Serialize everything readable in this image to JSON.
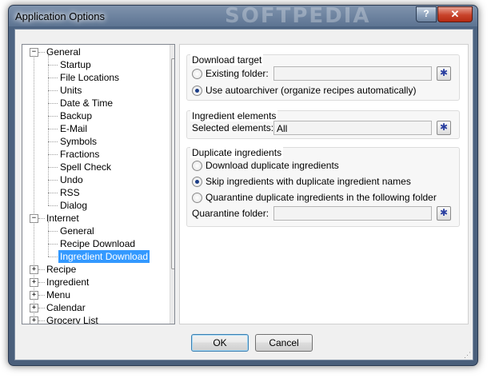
{
  "window": {
    "title": "Application Options",
    "watermark": "SOFTPEDIA",
    "help_glyph": "?",
    "close_glyph": "✕"
  },
  "tree": {
    "items": [
      {
        "label": "General",
        "level": 0,
        "expander": "−"
      },
      {
        "label": "Startup",
        "level": 1
      },
      {
        "label": "File Locations",
        "level": 1
      },
      {
        "label": "Units",
        "level": 1
      },
      {
        "label": "Date & Time",
        "level": 1
      },
      {
        "label": "Backup",
        "level": 1
      },
      {
        "label": "E-Mail",
        "level": 1
      },
      {
        "label": "Symbols",
        "level": 1
      },
      {
        "label": "Fractions",
        "level": 1
      },
      {
        "label": "Spell Check",
        "level": 1
      },
      {
        "label": "Undo",
        "level": 1
      },
      {
        "label": "RSS",
        "level": 1
      },
      {
        "label": "Dialog",
        "level": 1
      },
      {
        "label": "Internet",
        "level": 0,
        "expander": "−"
      },
      {
        "label": "General",
        "level": 1
      },
      {
        "label": "Recipe Download",
        "level": 1
      },
      {
        "label": "Ingredient Download",
        "level": 1,
        "selected": true
      },
      {
        "label": "Recipe",
        "level": 0,
        "expander": "+"
      },
      {
        "label": "Ingredient",
        "level": 0,
        "expander": "+"
      },
      {
        "label": "Menu",
        "level": 0,
        "expander": "+"
      },
      {
        "label": "Calendar",
        "level": 0,
        "expander": "+"
      },
      {
        "label": "Grocery List",
        "level": 0,
        "expander": "+"
      }
    ],
    "scroll_up": "▲",
    "scroll_down": "▼",
    "scroll_grip": "≡"
  },
  "download_target": {
    "title": "Download target",
    "existing_folder_label": "Existing folder:",
    "existing_folder_value": "",
    "autoarchiver_label": "Use autoarchiver (organize recipes automatically)",
    "browse_glyph": "✱"
  },
  "ingredient_elements": {
    "title": "Ingredient elements",
    "selected_label": "Selected elements:",
    "selected_value": "All"
  },
  "duplicate_ingredients": {
    "title": "Duplicate ingredients",
    "option_download": "Download duplicate ingredients",
    "option_skip": "Skip ingredients with duplicate ingredient names",
    "option_quarantine": "Quarantine duplicate ingredients in the following folder",
    "quarantine_label": "Quarantine folder:",
    "quarantine_value": ""
  },
  "buttons": {
    "ok": "OK",
    "cancel": "Cancel"
  },
  "colors": {
    "selection": "#3399ff",
    "titlebar": "#5d7492"
  }
}
